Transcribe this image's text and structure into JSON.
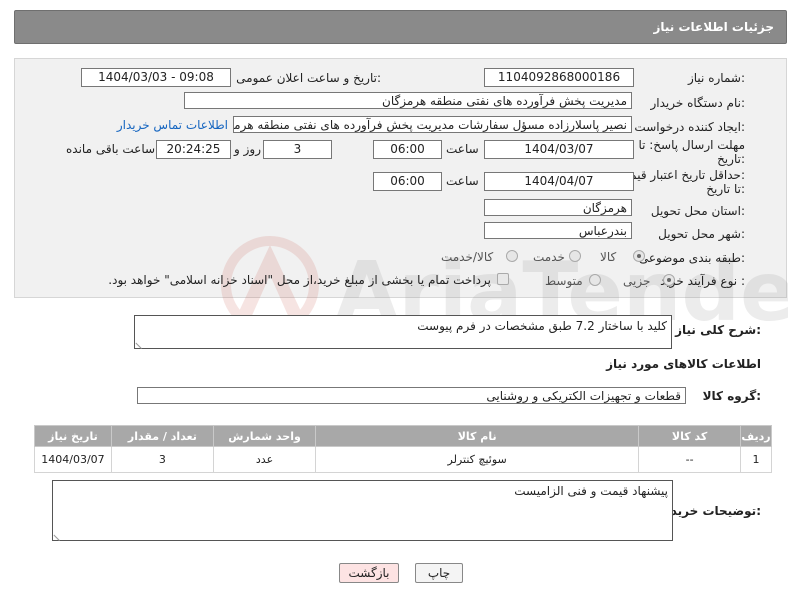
{
  "header": {
    "title": "جزئیات اطلاعات نیاز"
  },
  "form": {
    "need_number": {
      "label": "شماره نیاز:",
      "value": "1104092868000186"
    },
    "announce_datetime": {
      "label": "تاریخ و ساعت اعلان عمومی:",
      "value": "1404/03/03 - 09:08"
    },
    "buyer_org": {
      "label": "نام دستگاه خریدار:",
      "value": "مدیریت پخش فرآورده های نفتی منطقه هرمزگان"
    },
    "requester": {
      "label": "ایجاد کننده درخواست:",
      "value": "نصیر پاسلارزاده مسؤل سفارشات مدیریت پخش فرآورده های نفتی منطقه هرمزگ",
      "contact_link": "اطلاعات تماس خریدار"
    },
    "response_deadline": {
      "label_line1": "مهلت ارسال پاسخ: تا",
      "label_line2": "تاریخ:",
      "date": "1404/03/07",
      "time_label": "ساعت",
      "time": "06:00",
      "days": "3",
      "days_label": "روز و",
      "remaining": "20:24:25",
      "remaining_label": "ساعت باقی مانده"
    },
    "price_validity": {
      "label_line1": "حداقل تاریخ اعتبار قیمت:",
      "label_line2": "تا تاریخ:",
      "date": "1404/04/07",
      "time_label": "ساعت",
      "time": "06:00"
    },
    "delivery_province": {
      "label": "استان محل تحویل:",
      "value": "هرمزگان"
    },
    "delivery_city": {
      "label": "شهر محل تحویل:",
      "value": "بندرعباس"
    },
    "category": {
      "label": "طبقه بندی موضوعی:",
      "options": [
        "کالا",
        "خدمت",
        "کالا/خدمت"
      ],
      "selected": "کالا"
    },
    "purchase_process": {
      "label": "نوع فرآیند خرید :",
      "options": [
        "جزیی",
        "متوسط"
      ],
      "selected": "جزیی",
      "payment_note": "پرداخت تمام یا بخشی از مبلغ خرید،از محل \"اسناد خزانه اسلامی\" خواهد بود."
    }
  },
  "description": {
    "label": "شرح کلی نیاز:",
    "value": "کلید با ساختار 7.2 طبق مشخصات در فرم پیوست"
  },
  "goods_section": {
    "title": "اطلاعات کالاهای مورد نیاز"
  },
  "goods_group": {
    "label": "گروه کالا:",
    "value": "قطعات و تجهیزات الکتریکی و روشنایی"
  },
  "table": {
    "columns": [
      "ردیف",
      "کد کالا",
      "نام کالا",
      "واحد شمارش",
      "تعداد / مقدار",
      "تاریخ نیاز"
    ],
    "rows": [
      [
        "1",
        "--",
        "سوئیچ کنترلر",
        "عدد",
        "3",
        "1404/03/07"
      ]
    ]
  },
  "buyer_notes": {
    "label": "توضیحات خریدار:",
    "value": "پیشنهاد قیمت و فنی الزامیست"
  },
  "buttons": {
    "print": "چاپ",
    "back": "بازگشت"
  },
  "watermark": {
    "text": "AriaTender.net"
  },
  "colors": {
    "header_bg": "#8a8a8a",
    "panel_bg": "#f1f1f1",
    "link": "#1565c0",
    "back_button_bg": "#fde3e3",
    "table_header_bg": "#a8a8a8"
  }
}
